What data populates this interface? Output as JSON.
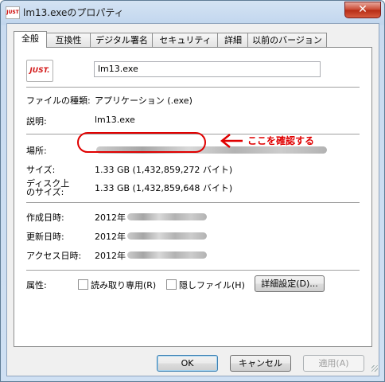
{
  "window": {
    "title": "lm13.exeのプロパティ",
    "close_glyph": "✕",
    "icon_label": "JUST"
  },
  "tabs": [
    "全般",
    "互換性",
    "デジタル署名",
    "セキュリティ",
    "詳細",
    "以前のバージョン"
  ],
  "general": {
    "app_icon_text": "JUST.",
    "file_name": "lm13.exe",
    "file_type_label": "ファイルの種類:",
    "file_type_value": "アプリケーション (.exe)",
    "description_label": "説明:",
    "description_value": "lm13.exe",
    "location_label": "場所:",
    "size_label": "サイズ:",
    "size_value": "1.33 GB (1,432,859,272 バイト)",
    "size_on_disk_label": "ディスク上\nのサイズ:",
    "size_on_disk_value": "1.33 GB (1,432,859,648 バイト)",
    "created_label": "作成日時:",
    "created_value": "2012年",
    "modified_label": "更新日時:",
    "modified_value": "2012年",
    "accessed_label": "アクセス日時:",
    "accessed_value": "2012年",
    "attributes_label": "属性:",
    "readonly_label": "読み取り専用(R)",
    "readonly_checked": false,
    "hidden_label": "隠しファイル(H)",
    "hidden_checked": false,
    "advanced_button": "詳細設定(D)..."
  },
  "annotation": {
    "text": "ここを確認する",
    "color": "#e00000"
  },
  "buttons": {
    "ok": "OK",
    "cancel": "キャンセル",
    "apply": "適用(A)"
  }
}
